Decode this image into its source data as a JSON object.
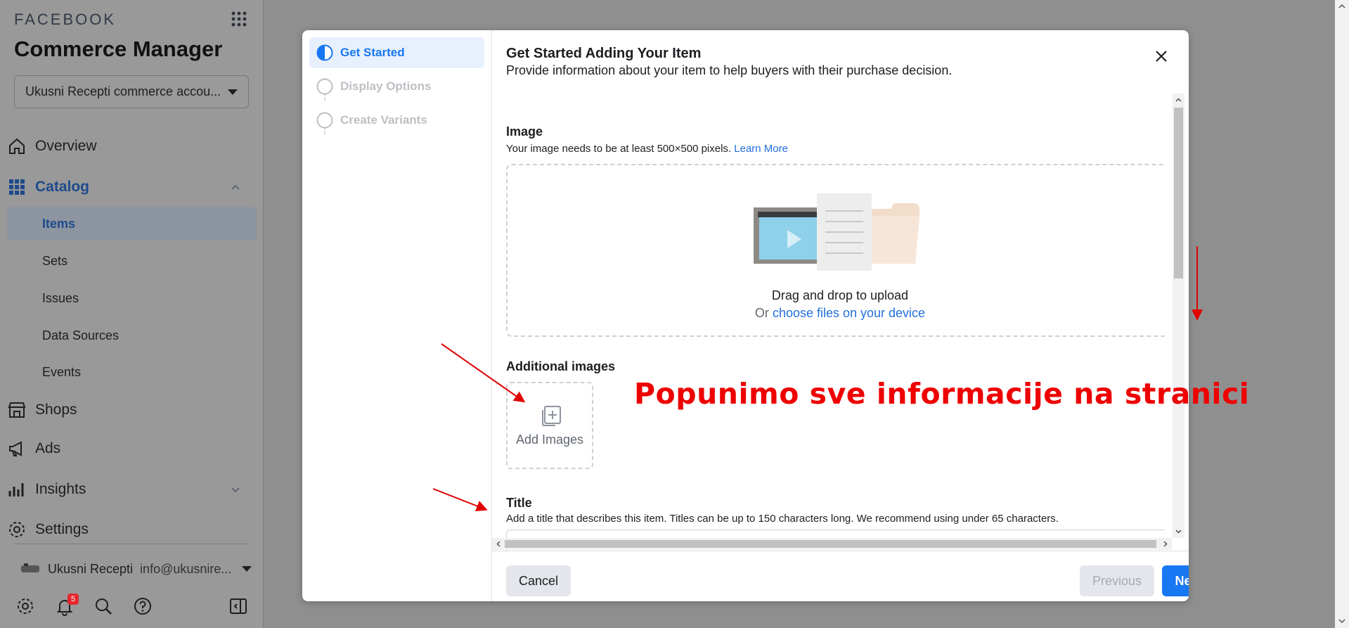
{
  "sidebar": {
    "brand": "FACEBOOK",
    "title": "Commerce Manager",
    "account": "Ukusni Recepti commerce accou...",
    "nav": {
      "overview": "Overview",
      "catalog": "Catalog",
      "items": "Items",
      "sets": "Sets",
      "issues": "Issues",
      "data_sources": "Data Sources",
      "events": "Events",
      "shops": "Shops",
      "ads": "Ads",
      "insights": "Insights",
      "settings": "Settings"
    },
    "user": {
      "name": "Ukusni Recepti",
      "email": "info@ukusnire..."
    },
    "notification_count": "5"
  },
  "modal": {
    "steps": [
      "Get Started",
      "Display Options",
      "Create Variants"
    ],
    "title": "Get Started Adding Your Item",
    "subtitle": "Provide information about your item to help buyers with their purchase decision.",
    "image_label": "Image",
    "image_help": "Your image needs to be at least 500×500 pixels.",
    "learn_more": "Learn More",
    "drag_text": "Drag and drop to upload",
    "or_text": "Or",
    "choose_files": "choose files on your device",
    "additional_label": "Additional images",
    "add_images": "Add Images",
    "title_label": "Title",
    "title_help": "Add a title that describes this item. Titles can be up to 150 characters long. We recommend using under 65 characters.",
    "title_value": "",
    "buttons": {
      "cancel": "Cancel",
      "previous": "Previous",
      "next": "Next"
    }
  },
  "annotation": {
    "text": "Popunimo sve informacije na stranici",
    "color": "#e00000"
  },
  "colors": {
    "accent": "#1877f2",
    "active_nav": "#1e4a8c",
    "step_active_bg": "#e7f0fd"
  }
}
